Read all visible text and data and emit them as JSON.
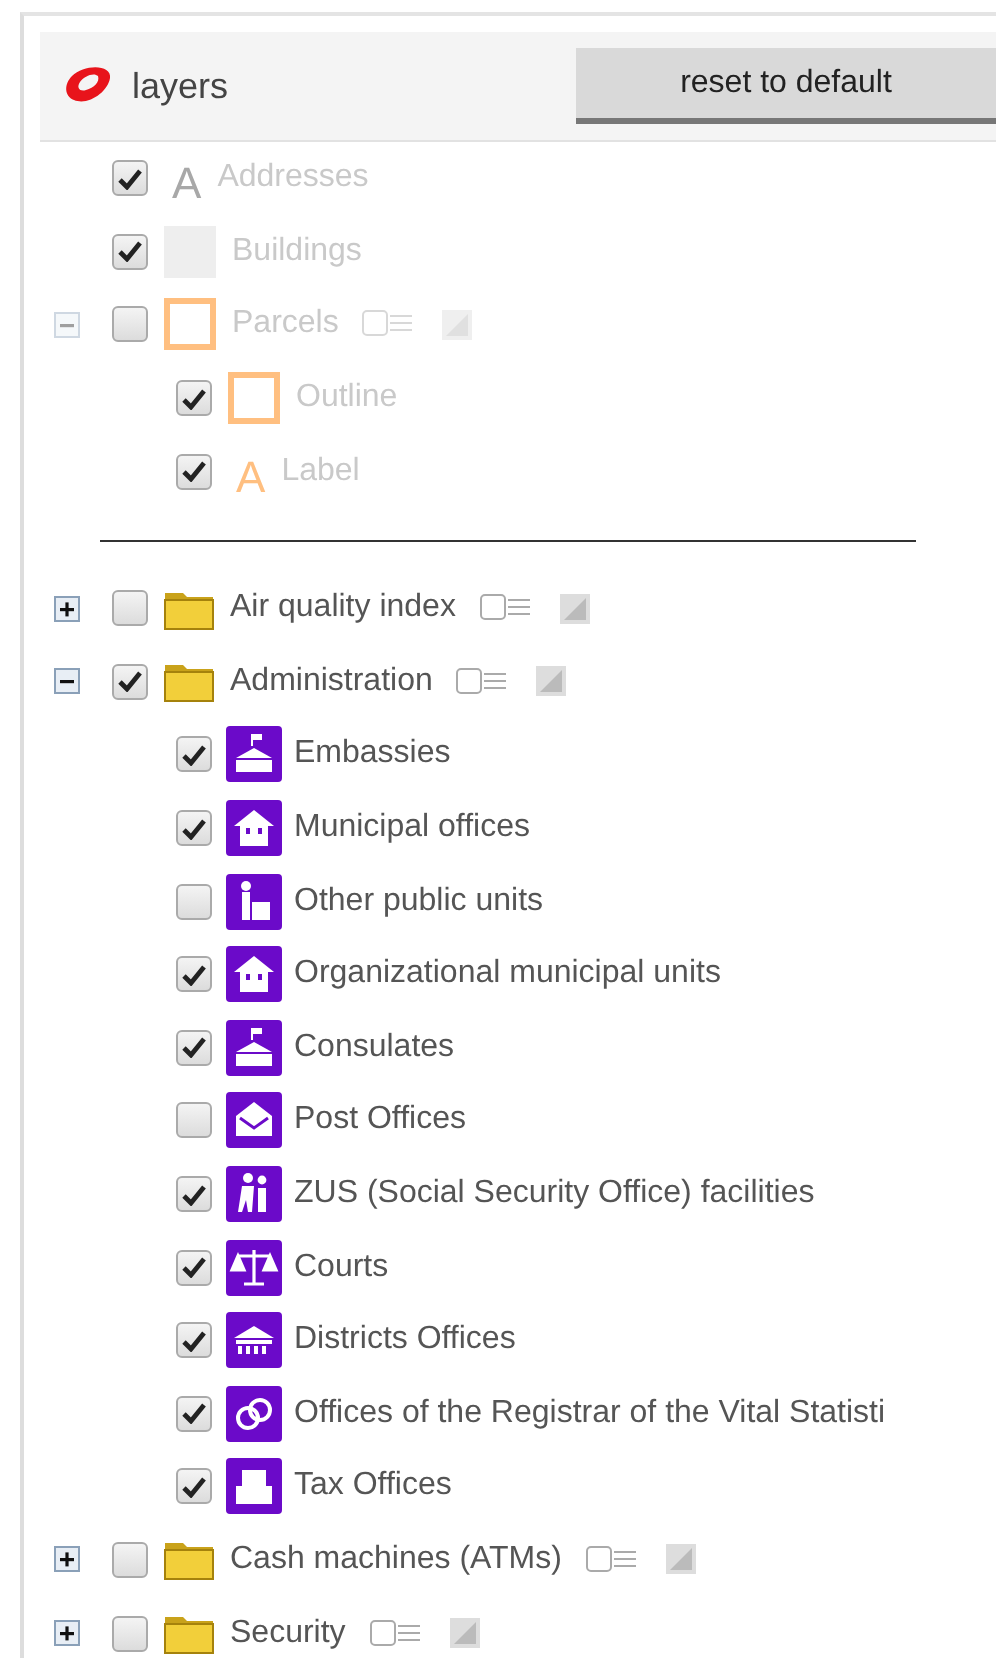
{
  "header": {
    "title": "layers",
    "reset_button": "reset to default"
  },
  "base_layers": {
    "disabled": true,
    "items": [
      {
        "label": "Addresses",
        "checked": true,
        "kind": "text",
        "glyph": "A",
        "color": "#a8a8a8"
      },
      {
        "label": "Buildings",
        "checked": true,
        "kind": "fill",
        "color": "#eeeeee"
      },
      {
        "label": "Parcels",
        "checked": false,
        "kind": "outline",
        "color": "#ffbf80",
        "expanded": true,
        "tools": true,
        "children": [
          {
            "label": "Outline",
            "checked": true,
            "kind": "outline",
            "color": "#ffbf80"
          },
          {
            "label": "Label",
            "checked": true,
            "kind": "text",
            "glyph": "A",
            "color": "#ffbf80"
          }
        ]
      }
    ]
  },
  "thematic_layers": [
    {
      "label": "Air quality index",
      "checked": false,
      "expanded": false,
      "tools": true,
      "kind": "folder"
    },
    {
      "label": "Administration",
      "checked": true,
      "expanded": true,
      "tools": true,
      "kind": "folder",
      "children": [
        {
          "label": "Embassies",
          "checked": true,
          "kind": "embassy"
        },
        {
          "label": "Municipal offices",
          "checked": true,
          "kind": "house"
        },
        {
          "label": "Other public units",
          "checked": false,
          "kind": "clerk"
        },
        {
          "label": "Organizational municipal units",
          "checked": true,
          "kind": "house"
        },
        {
          "label": "Consulates",
          "checked": true,
          "kind": "embassy"
        },
        {
          "label": "Post Offices",
          "checked": false,
          "kind": "post"
        },
        {
          "label": "ZUS (Social Security Office) facilities",
          "checked": true,
          "kind": "elderly"
        },
        {
          "label": "Courts",
          "checked": true,
          "kind": "scales"
        },
        {
          "label": "Districts Offices",
          "checked": true,
          "kind": "hall"
        },
        {
          "label": "Offices of the Registrar of the Vital Statisti",
          "checked": true,
          "kind": "rings"
        },
        {
          "label": "Tax Offices",
          "checked": true,
          "kind": "tower"
        }
      ]
    },
    {
      "label": "Cash machines (ATMs)",
      "checked": false,
      "expanded": false,
      "tools": true,
      "kind": "folder"
    },
    {
      "label": "Security",
      "checked": false,
      "expanded": false,
      "tools": true,
      "kind": "folder"
    }
  ]
}
